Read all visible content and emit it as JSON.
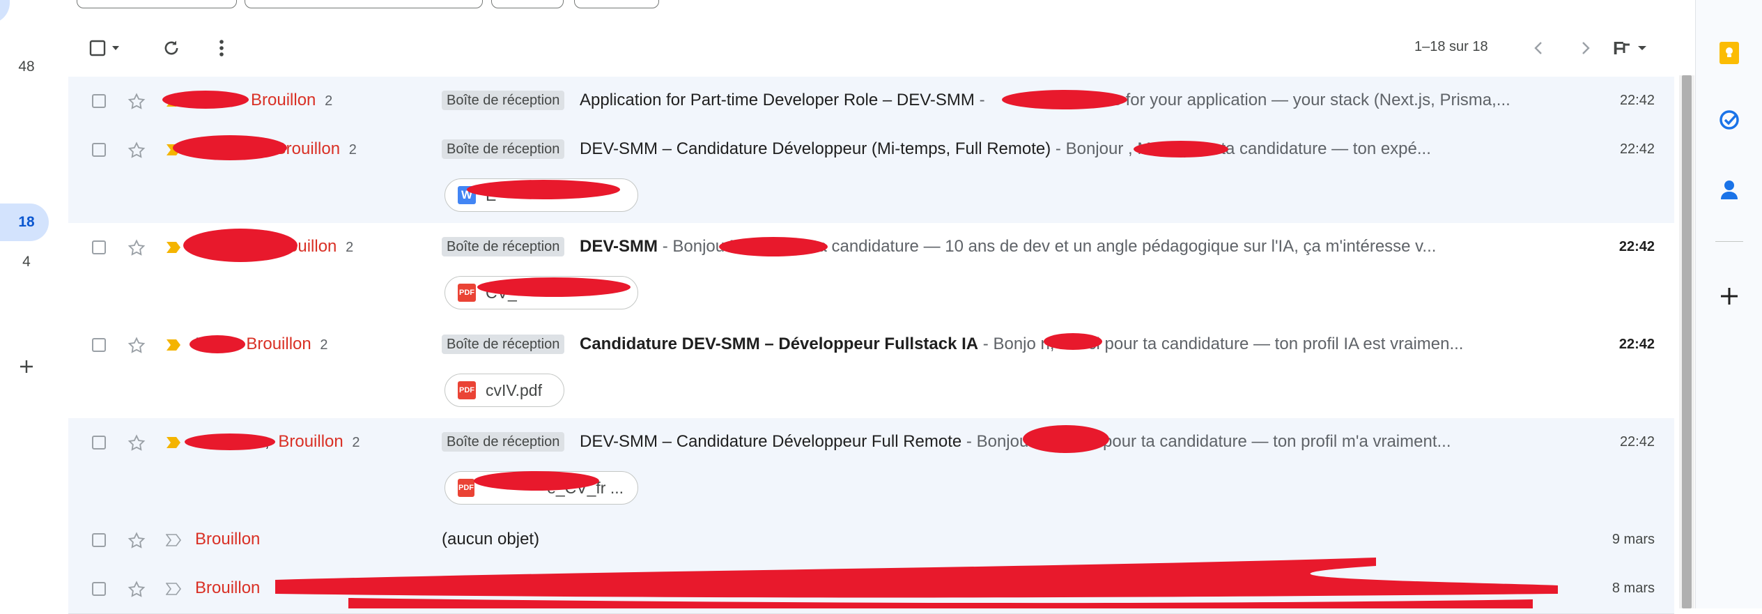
{
  "left_rail": {
    "counts": [
      "48",
      "4"
    ],
    "active_count": "18"
  },
  "toolbar": {
    "pagination": "1–18 sur 18",
    "input_tools_label": "F"
  },
  "label_inbox": "Boîte de réception",
  "draft_word": "Brouillon",
  "emails": [
    {
      "sender_prefix": "",
      "sender_draft": "Brouillon",
      "thread_count": "2",
      "label": "Boîte de réception",
      "subject": "Application for Part-time Developer Role – DEV-SMM",
      "snippet": "Thanks for your application — your stack (Next.js, Prisma,...",
      "date": "22:42",
      "unread": false,
      "attachment": null
    },
    {
      "sender_prefix": "l,",
      "sender_draft": "Brouillon",
      "thread_count": "2",
      "label": "Boîte de réception",
      "subject": "DEV-SMM – Candidature Développeur (Mi-temps, Full Remote)",
      "snippet": "Bonjour , Merci pour ta candidature — ton expé...",
      "date": "22:42",
      "unread": false,
      "attachment": {
        "type": "word",
        "icon_text": "W",
        "name": "E"
      }
    },
    {
      "sender_prefix": "",
      "sender_draft": "Brouillon",
      "thread_count": "2",
      "label": "Boîte de réception",
      "subject": "DEV-SMM",
      "snippet": "Bonjou Merci pour ta candidature — 10 ans de dev et un angle pédagogique sur l'IA, ça m'intéresse v...",
      "date": "22:42",
      "unread": true,
      "attachment": {
        "type": "pdf",
        "icon_text": "PDF",
        "name": "CV_"
      }
    },
    {
      "sender_prefix": "I",
      "sender_draft": "Brouillon",
      "thread_count": "2",
      "label": "Boîte de réception",
      "subject": "Candidature DEV-SMM – Développeur Fullstack IA",
      "snippet": "Bonjo n, Merci pour ta candidature — ton profil IA est vraimen...",
      "date": "22:42",
      "unread": true,
      "attachment": {
        "type": "pdf",
        "icon_text": "PDF",
        "name": "cvIV.pdf"
      }
    },
    {
      "sender_prefix": ",",
      "sender_draft": "Brouillon",
      "thread_count": "2",
      "label": "Boîte de réception",
      "subject": "DEV-SMM – Candidature Développeur Full Remote",
      "snippet": "Bonjour e, Merci pour ta candidature — ton profil m'a vraiment...",
      "date": "22:42",
      "unread": false,
      "attachment": {
        "type": "pdf",
        "icon_text": "PDF",
        "name": "e_CV_fr ..."
      }
    },
    {
      "sender_prefix": "",
      "sender_draft": "Brouillon",
      "thread_count": "",
      "label": "",
      "subject": "(aucun objet)",
      "snippet": "",
      "date": "9 mars",
      "unread": false,
      "attachment": null
    },
    {
      "sender_prefix": "",
      "sender_draft": "Brouillon",
      "thread_count": "",
      "label": "",
      "subject": "",
      "snippet": "",
      "date": "8 mars",
      "unread": false,
      "attachment": null
    }
  ],
  "colors": {
    "draft_red": "#d93025",
    "read_row_bg": "#f2f6fc",
    "accent_blue": "#0b57d0",
    "redaction": "#e8192c",
    "important_yellow": "#f4b400",
    "keep_yellow": "#fbbc04"
  },
  "right_panel_icons": [
    "keep-icon",
    "tasks-icon",
    "contacts-icon",
    "add-addon-icon"
  ]
}
